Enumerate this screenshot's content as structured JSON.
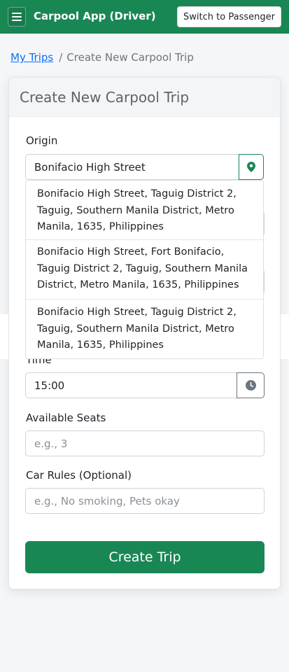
{
  "navbar": {
    "title": "Carpool App (Driver)",
    "switch_label": "Switch to Passenger",
    "brand_color": "#198754"
  },
  "breadcrumb": {
    "link": "My Trips",
    "separator": "/",
    "current": "Create New Carpool Trip"
  },
  "card": {
    "title": "Create New Carpool Trip"
  },
  "form": {
    "origin": {
      "label": "Origin",
      "value": "Bonifacio High Street",
      "icon": "map-pin-icon"
    },
    "time": {
      "label": "Time",
      "value": "15:00",
      "icon": "clock-icon"
    },
    "seats": {
      "label": "Available Seats",
      "placeholder": "e.g., 3"
    },
    "rules": {
      "label": "Car Rules (Optional)",
      "placeholder": "e.g., No smoking, Pets okay"
    },
    "submit_label": "Create Trip"
  },
  "suggestions": [
    "Bonifacio High Street, Taguig District 2, Taguig, Southern Manila District, Metro Manila, 1635, Philippines",
    "Bonifacio High Street, Fort Bonifacio, Taguig District 2, Taguig, Southern Manila District, Metro Manila, 1635, Philippines",
    "Bonifacio High Street, Taguig District 2, Taguig, Southern Manila District, Metro Manila, 1635, Philippines"
  ]
}
